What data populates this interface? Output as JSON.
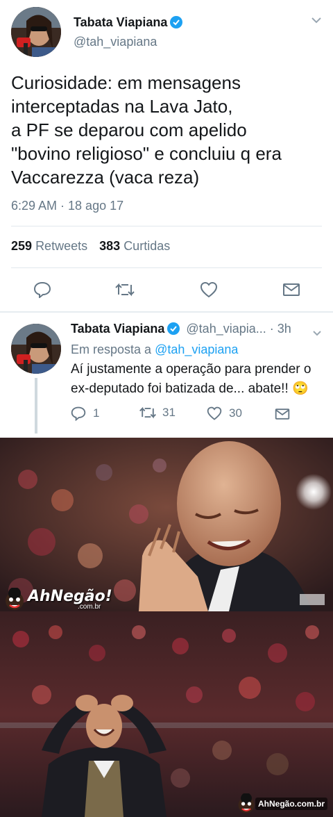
{
  "tweet": {
    "author_name": "Tabata Viapiana",
    "author_handle": "@tah_viapiana",
    "text_lines": [
      "Curiosidade: em mensagens",
      "interceptadas na Lava Jato,",
      "a PF se deparou com apelido",
      "\"bovino religioso\" e concluiu q era",
      "Vaccarezza (vaca reza)"
    ],
    "timestamp": "6:29 AM · 18 ago 17",
    "retweets_count": "259",
    "retweets_label": "Retweets",
    "likes_count": "383",
    "likes_label": "Curtidas"
  },
  "reply": {
    "author_name": "Tabata Viapiana",
    "author_handle": "@tah_viapia...",
    "age": "· 3h",
    "in_reply_prefix": "Em resposta a",
    "in_reply_handle": "@tah_viapiana",
    "text_lines": [
      "Aí justamente a operação para prender o",
      "ex-deputado foi batizada de... abate!! 🙄"
    ],
    "reply_count": "1",
    "retweet_count": "31",
    "like_count": "30"
  },
  "watermark": {
    "brand_top": "AhNegão!",
    "brand_top_sub": ".com.br",
    "brand_bottom": "AhNegão.com.br"
  },
  "colors": {
    "accent": "#1da1f2",
    "secondary_text": "#657786",
    "divider": "#e1e8ed"
  }
}
